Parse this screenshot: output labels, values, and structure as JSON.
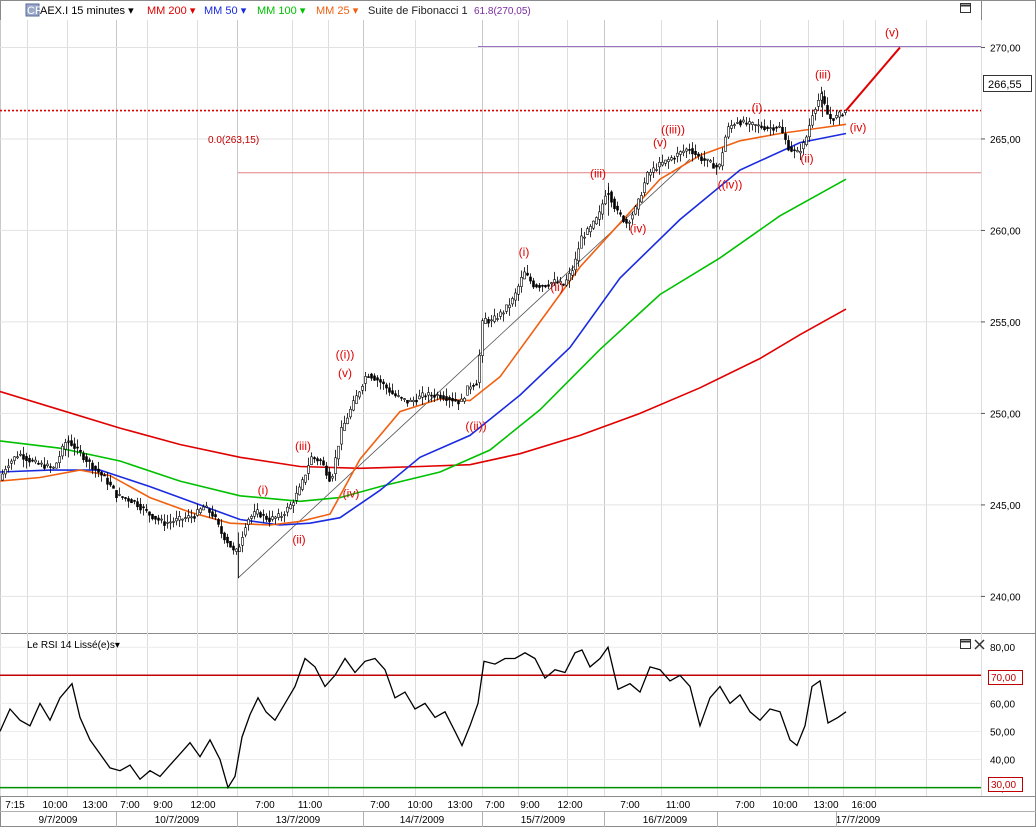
{
  "header": {
    "badge": "CFD",
    "symbol": "AEX.I",
    "timeframe": "15 minutes",
    "indicators": [
      {
        "label": "MM 200",
        "color": "#e00000"
      },
      {
        "label": "MM 50",
        "color": "#1a2be0"
      },
      {
        "label": "MM 100",
        "color": "#00c000"
      },
      {
        "label": "MM 25",
        "color": "#f06010"
      },
      {
        "label": "Suite de Fibonacci 1",
        "color": "#222222"
      }
    ],
    "fib_top_label": "61.8(270,05)",
    "fib_bottom_label": "0.0(263,15)",
    "last_price": "266,55"
  },
  "rsi_panel": {
    "title": "Le RSI 14 Lissé(e)s",
    "overbought_label": "70,00",
    "oversold_label": "30,00"
  },
  "chart_data": [
    {
      "type": "candlestick",
      "title": "",
      "ylim": [
        238,
        271.5
      ],
      "y_ticks": [
        "240,00",
        "245,00",
        "250,00",
        "255,00",
        "260,00",
        "265,00",
        "270,00"
      ],
      "x_time_ticks": [
        "7:15",
        "10:00",
        "13:00",
        "7:00",
        "9:00",
        "12:00",
        "7:00",
        "11:00",
        "7:00",
        "10:00",
        "13:00",
        "7:00",
        "9:00",
        "12:00",
        "7:00",
        "11:00",
        "7:00",
        "10:00",
        "13:00",
        "16:00"
      ],
      "x_date_ticks": [
        "9/7/2009",
        "10/7/2009",
        "13/7/2009",
        "14/7/2009",
        "15/7/2009",
        "16/7/2009",
        "17/7/2009"
      ],
      "price_path": [
        [
          0,
          246.3
        ],
        [
          8,
          247.2
        ],
        [
          20,
          247.8
        ],
        [
          35,
          247.3
        ],
        [
          55,
          247.0
        ],
        [
          68,
          248.6
        ],
        [
          80,
          247.9
        ],
        [
          92,
          247.2
        ],
        [
          105,
          246.5
        ],
        [
          112,
          246.0
        ],
        [
          118,
          245.5
        ],
        [
          135,
          245.2
        ],
        [
          150,
          244.5
        ],
        [
          165,
          244.0
        ],
        [
          180,
          244.2
        ],
        [
          195,
          244.4
        ],
        [
          205,
          244.9
        ],
        [
          215,
          244.4
        ],
        [
          222,
          243.5
        ],
        [
          230,
          242.9
        ],
        [
          236,
          242.3
        ],
        [
          240,
          242.7
        ],
        [
          248,
          244.2
        ],
        [
          258,
          244.6
        ],
        [
          270,
          244.2
        ],
        [
          282,
          244.4
        ],
        [
          292,
          245.0
        ],
        [
          302,
          246.0
        ],
        [
          312,
          247.6
        ],
        [
          322,
          247.4
        ],
        [
          332,
          246.3
        ],
        [
          342,
          249.0
        ],
        [
          350,
          250.0
        ],
        [
          360,
          251.2
        ],
        [
          368,
          252.2
        ],
        [
          380,
          251.8
        ],
        [
          395,
          251.0
        ],
        [
          410,
          250.6
        ],
        [
          425,
          251.0
        ],
        [
          440,
          251.0
        ],
        [
          452,
          250.8
        ],
        [
          462,
          250.6
        ],
        [
          470,
          251.5
        ],
        [
          478,
          251.7
        ],
        [
          484,
          255.2
        ],
        [
          492,
          255.0
        ],
        [
          505,
          255.6
        ],
        [
          515,
          256.3
        ],
        [
          525,
          257.7
        ],
        [
          535,
          257.0
        ],
        [
          545,
          257.0
        ],
        [
          555,
          257.2
        ],
        [
          565,
          257.0
        ],
        [
          575,
          258.0
        ],
        [
          582,
          259.6
        ],
        [
          590,
          260.0
        ],
        [
          600,
          260.8
        ],
        [
          608,
          262.3
        ],
        [
          618,
          261.0
        ],
        [
          628,
          260.4
        ],
        [
          638,
          261.3
        ],
        [
          648,
          263.0
        ],
        [
          658,
          263.5
        ],
        [
          668,
          263.8
        ],
        [
          680,
          264.2
        ],
        [
          690,
          264.5
        ],
        [
          700,
          264.0
        ],
        [
          710,
          263.7
        ],
        [
          720,
          263.4
        ],
        [
          728,
          265.5
        ],
        [
          738,
          266.0
        ],
        [
          748,
          265.8
        ],
        [
          760,
          265.7
        ],
        [
          770,
          265.6
        ],
        [
          780,
          265.7
        ],
        [
          790,
          264.5
        ],
        [
          798,
          264.2
        ],
        [
          806,
          264.8
        ],
        [
          814,
          266.5
        ],
        [
          822,
          267.4
        ],
        [
          830,
          266.1
        ],
        [
          838,
          266.2
        ],
        [
          846,
          266.55
        ]
      ],
      "moving_averages": [
        {
          "name": "MM 200",
          "color": "#e00000",
          "points": [
            [
              0,
              251.2
            ],
            [
              60,
              250.2
            ],
            [
              120,
              249.2
            ],
            [
              180,
              248.3
            ],
            [
              240,
              247.6
            ],
            [
              300,
              247.1
            ],
            [
              360,
              247.0
            ],
            [
              420,
              247.1
            ],
            [
              470,
              247.2
            ],
            [
              520,
              247.8
            ],
            [
              580,
              248.8
            ],
            [
              640,
              250.0
            ],
            [
              700,
              251.4
            ],
            [
              760,
              253.0
            ],
            [
              800,
              254.3
            ],
            [
              846,
              255.7
            ]
          ]
        },
        {
          "name": "MM 100",
          "color": "#00c000",
          "points": [
            [
              0,
              248.5
            ],
            [
              60,
              248.1
            ],
            [
              120,
              247.4
            ],
            [
              180,
              246.3
            ],
            [
              240,
              245.5
            ],
            [
              300,
              245.2
            ],
            [
              340,
              245.4
            ],
            [
              380,
              246.0
            ],
            [
              440,
              246.8
            ],
            [
              490,
              248.0
            ],
            [
              540,
              250.2
            ],
            [
              600,
              253.5
            ],
            [
              660,
              256.5
            ],
            [
              720,
              258.5
            ],
            [
              780,
              260.8
            ],
            [
              846,
              262.8
            ]
          ]
        },
        {
          "name": "MM 50",
          "color": "#1a2be0",
          "points": [
            [
              0,
              246.8
            ],
            [
              50,
              246.9
            ],
            [
              100,
              246.9
            ],
            [
              150,
              246.0
            ],
            [
              200,
              245.0
            ],
            [
              240,
              244.2
            ],
            [
              280,
              243.9
            ],
            [
              310,
              244.0
            ],
            [
              340,
              244.3
            ],
            [
              380,
              245.8
            ],
            [
              420,
              247.6
            ],
            [
              470,
              248.8
            ],
            [
              520,
              251.0
            ],
            [
              570,
              253.6
            ],
            [
              620,
              257.4
            ],
            [
              680,
              260.6
            ],
            [
              740,
              263.3
            ],
            [
              800,
              264.8
            ],
            [
              846,
              265.3
            ]
          ]
        },
        {
          "name": "MM 25",
          "color": "#f06010",
          "points": [
            [
              0,
              246.3
            ],
            [
              40,
              246.5
            ],
            [
              80,
              246.9
            ],
            [
              110,
              246.6
            ],
            [
              150,
              245.4
            ],
            [
              190,
              244.6
            ],
            [
              230,
              244.0
            ],
            [
              270,
              243.9
            ],
            [
              300,
              244.1
            ],
            [
              330,
              244.5
            ],
            [
              360,
              247.5
            ],
            [
              400,
              250.1
            ],
            [
              440,
              250.8
            ],
            [
              470,
              250.7
            ],
            [
              500,
              252.0
            ],
            [
              540,
              255.0
            ],
            [
              580,
              258.0
            ],
            [
              620,
              260.4
            ],
            [
              660,
              262.8
            ],
            [
              700,
              264.1
            ],
            [
              740,
              264.9
            ],
            [
              780,
              265.3
            ],
            [
              820,
              265.6
            ],
            [
              846,
              265.8
            ]
          ]
        }
      ],
      "projection": {
        "from": [
          846,
          266.55
        ],
        "to": [
          900,
          270.0
        ],
        "color": "#e00000"
      },
      "trendline": {
        "from": [
          238,
          241.0
        ],
        "to": [
          690,
          263.9
        ]
      },
      "wave_labels": [
        {
          "text": "(i)",
          "x": 263,
          "y": 245.6
        },
        {
          "text": "(ii)",
          "x": 299,
          "y": 242.9
        },
        {
          "text": "(iii)",
          "x": 303,
          "y": 248.0
        },
        {
          "text": "(iv)",
          "x": 351,
          "y": 245.4
        },
        {
          "text": "((i))",
          "x": 345,
          "y": 253.0
        },
        {
          "text": "(v)",
          "x": 345,
          "y": 252.0
        },
        {
          "text": "((ii))",
          "x": 476,
          "y": 249.1
        },
        {
          "text": "(i)",
          "x": 524,
          "y": 258.6
        },
        {
          "text": "(ii)",
          "x": 557,
          "y": 256.7
        },
        {
          "text": "(iii)",
          "x": 598,
          "y": 262.9
        },
        {
          "text": "(iv)",
          "x": 638,
          "y": 259.9
        },
        {
          "text": "(v)",
          "x": 660,
          "y": 264.6
        },
        {
          "text": "((iii))",
          "x": 673,
          "y": 265.3
        },
        {
          "text": "((iv))",
          "x": 730,
          "y": 262.3
        },
        {
          "text": "(i)",
          "x": 757,
          "y": 266.5
        },
        {
          "text": "(ii)",
          "x": 807,
          "y": 263.7
        },
        {
          "text": "(iii)",
          "x": 823,
          "y": 268.3
        },
        {
          "text": "(iv)",
          "x": 858,
          "y": 265.4
        },
        {
          "text": "(v)",
          "x": 892,
          "y": 270.6
        }
      ]
    },
    {
      "type": "line",
      "title": "Le RSI 14 Lissé(e)s",
      "ylim": [
        27,
        84
      ],
      "y_ticks": [
        "30,00",
        "40,00",
        "50,00",
        "60,00",
        "70,00",
        "80,00"
      ],
      "levels": [
        {
          "value": 70,
          "color": "#c00000"
        },
        {
          "value": 30,
          "color": "#009000"
        }
      ],
      "points": [
        [
          0,
          50
        ],
        [
          10,
          58
        ],
        [
          20,
          54
        ],
        [
          30,
          52
        ],
        [
          40,
          60
        ],
        [
          50,
          54
        ],
        [
          60,
          62
        ],
        [
          72,
          67
        ],
        [
          80,
          55
        ],
        [
          90,
          47
        ],
        [
          100,
          42
        ],
        [
          110,
          37
        ],
        [
          120,
          36
        ],
        [
          130,
          38
        ],
        [
          140,
          33
        ],
        [
          150,
          36
        ],
        [
          160,
          34
        ],
        [
          170,
          38
        ],
        [
          180,
          42
        ],
        [
          190,
          46
        ],
        [
          200,
          41
        ],
        [
          210,
          47
        ],
        [
          220,
          40
        ],
        [
          228,
          30
        ],
        [
          235,
          34
        ],
        [
          242,
          48
        ],
        [
          250,
          56
        ],
        [
          258,
          62
        ],
        [
          266,
          57
        ],
        [
          275,
          54
        ],
        [
          285,
          60
        ],
        [
          295,
          66
        ],
        [
          305,
          76
        ],
        [
          315,
          73
        ],
        [
          325,
          66
        ],
        [
          335,
          70
        ],
        [
          345,
          76
        ],
        [
          355,
          71
        ],
        [
          365,
          75
        ],
        [
          375,
          76
        ],
        [
          385,
          72
        ],
        [
          395,
          62
        ],
        [
          405,
          64
        ],
        [
          415,
          58
        ],
        [
          425,
          60
        ],
        [
          435,
          55
        ],
        [
          445,
          57
        ],
        [
          455,
          50
        ],
        [
          462,
          45
        ],
        [
          470,
          52
        ],
        [
          478,
          60
        ],
        [
          484,
          75
        ],
        [
          495,
          74
        ],
        [
          505,
          76
        ],
        [
          515,
          76
        ],
        [
          525,
          78
        ],
        [
          535,
          76
        ],
        [
          545,
          69
        ],
        [
          555,
          72
        ],
        [
          565,
          71
        ],
        [
          575,
          78
        ],
        [
          582,
          79
        ],
        [
          590,
          73
        ],
        [
          600,
          76
        ],
        [
          608,
          80
        ],
        [
          618,
          65
        ],
        [
          630,
          67
        ],
        [
          640,
          64
        ],
        [
          650,
          73
        ],
        [
          660,
          72
        ],
        [
          670,
          68
        ],
        [
          680,
          70
        ],
        [
          690,
          66
        ],
        [
          700,
          52
        ],
        [
          710,
          62
        ],
        [
          720,
          66
        ],
        [
          730,
          60
        ],
        [
          740,
          63
        ],
        [
          750,
          57
        ],
        [
          760,
          54
        ],
        [
          770,
          58
        ],
        [
          780,
          57
        ],
        [
          790,
          47
        ],
        [
          797,
          45
        ],
        [
          805,
          52
        ],
        [
          812,
          66
        ],
        [
          820,
          68
        ],
        [
          828,
          53
        ],
        [
          838,
          55
        ],
        [
          846,
          57
        ]
      ]
    }
  ]
}
